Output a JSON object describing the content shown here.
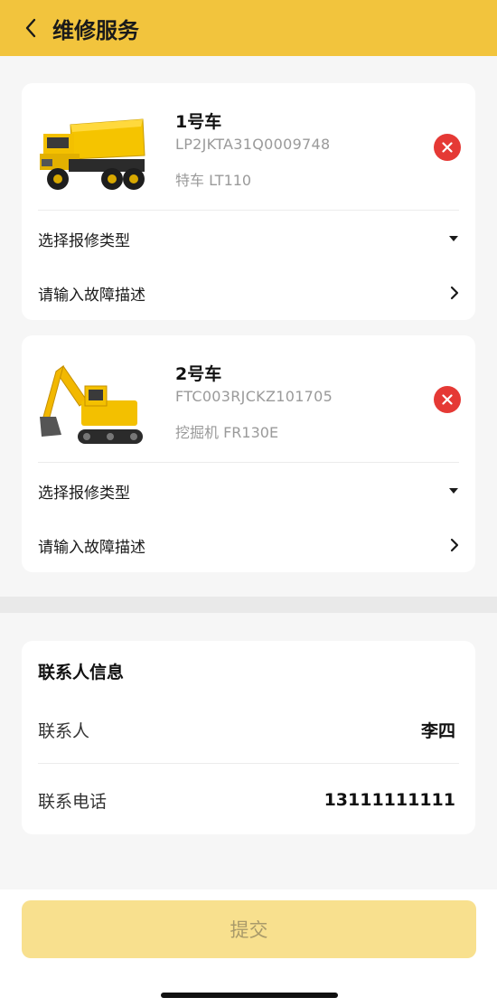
{
  "header": {
    "title": "维修服务"
  },
  "vehicles": [
    {
      "name": "1号车",
      "vin": "LP2JKTA31Q0009748",
      "model": "特车 LT110",
      "repair_type_placeholder": "选择报修类型",
      "fault_placeholder": "请输入故障描述",
      "image_icon": "dump-truck"
    },
    {
      "name": "2号车",
      "vin": "FTC003RJCKZ101705",
      "model": "挖掘机 FR130E",
      "repair_type_placeholder": "选择报修类型",
      "fault_placeholder": "请输入故障描述",
      "image_icon": "excavator"
    }
  ],
  "contact": {
    "title": "联系人信息",
    "person_label": "联系人",
    "person_value": "李四",
    "phone_label": "联系电话",
    "phone_value": "13111111111"
  },
  "footer": {
    "submit_label": "提交"
  },
  "colors": {
    "brand": "#f2c43d",
    "remove": "#e53935",
    "submit_disabled": "#f8e08e"
  }
}
